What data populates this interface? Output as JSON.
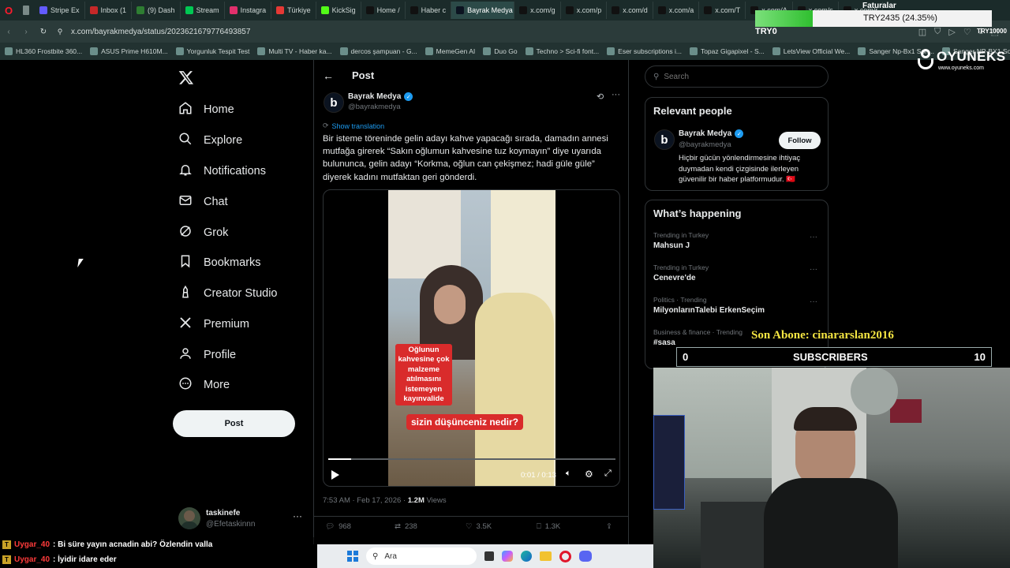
{
  "browser": {
    "tabs": [
      "Stripe Ex",
      "Inbox (1",
      "(9) Dash",
      "Stream",
      "Instagra",
      "Türkiye",
      "KickSig",
      "Home /",
      "Haber c",
      "Bayrak Medya",
      "x.com/g",
      "x.com/p",
      "x.com/d",
      "x.com/a",
      "x.com/T",
      "x.com/A",
      "x.com/s",
      "x.com/r"
    ],
    "url": "x.com/bayrakmedya/status/2023621679776493857",
    "bookmarks": [
      "HL360 Frostbite 360...",
      "ASUS Prime H610M...",
      "Yorgunluk Tespit Test",
      "Multi TV - Haber ka...",
      "dercos şampuan - G...",
      "MemeGen AI",
      "Duo Go",
      "Techno > Sci-fi font...",
      "Eser subscriptions i...",
      "Topaz Gigapixel - S...",
      "LetsView Official We...",
      "Sanger Np-Bx1 Son...",
      "Sanger NP-BX1 Son..."
    ]
  },
  "nav": {
    "items": [
      "Home",
      "Explore",
      "Notifications",
      "Chat",
      "Grok",
      "Bookmarks",
      "Creator Studio",
      "Premium",
      "Profile",
      "More"
    ],
    "post_button": "Post",
    "account_name": "taskinefe",
    "account_handle": "@Efetaskinnn"
  },
  "post": {
    "header": "Post",
    "author_name": "Bayrak Medya",
    "author_handle": "@bayrakmedya",
    "show_translation": "Show translation",
    "text": "Bir isteme töreninde gelin adayı kahve yapacağı sırada, damadın annesi mutfağa girerek “Sakın oğlumun kahvesine tuz koymayın” diye uyarıda bulununca, gelin adayı “Korkma, oğlun can çekişmez; hadi güle güle” diyerek kadını mutfaktan geri gönderdi.",
    "video_caption": "Oğlunun kahvesine çok malzeme atılmasını istemeyen kayınvalide",
    "video_question": "sizin düşünceniz nedir?",
    "video_time": "0:01 / 0:13",
    "video_progress": 0.08,
    "timestamp": "7:53 AM · Feb 17, 2026 · ",
    "views_count": "1.2M",
    "views_label": " Views",
    "replies": "968",
    "reposts": "238",
    "likes": "3.5K",
    "bookmarks": "1.3K"
  },
  "search": {
    "placeholder": "Search"
  },
  "relevant": {
    "title": "Relevant people",
    "name": "Bayrak Medya",
    "handle": "@bayrakmedya",
    "follow": "Follow",
    "bio": "Hiçbir gücün yönlendirmesine ihtiyaç duymadan kendi çizgisinde ilerleyen güvenilir bir haber platformudur. 🇹🇷"
  },
  "happening": {
    "title": "What’s happening",
    "trends": [
      {
        "meta": "Trending in Turkey",
        "name": "Mahsun J"
      },
      {
        "meta": "Trending in Turkey",
        "name": "Cenevre'de"
      },
      {
        "meta": "Politics · Trending",
        "name": "MilyonlarınTalebi ErkenSeçim"
      },
      {
        "meta": "Business & finance · Trending",
        "name": "#sasa"
      }
    ]
  },
  "stream": {
    "balance_label": "Faturalar",
    "goal_text": "TRY2435 (24.35%)",
    "goal_progress": 0.2435,
    "goal_current": "TRY0",
    "goal_target": "TRY10000",
    "brand": "OYUNEKS",
    "brand_sub": "www.oyuneks.com",
    "last_sub": "Son Abone: cinararslan2016",
    "subs_left": "0",
    "subs_label": "SUBSCRIBERS",
    "subs_right": "10",
    "chat": [
      {
        "user": "Uygar_40",
        "msg": ": Bi süre yayın acnadin abi? Özlendin valla"
      },
      {
        "user": "Uygar_40",
        "msg": ": İyidir idare eder"
      }
    ]
  },
  "taskbar": {
    "search": "Ara"
  },
  "colors": {
    "accent": "#1d9bf0",
    "bg": "#000000",
    "goal_green": "#3fbf3f",
    "subs_yellow": "#f5e642"
  }
}
